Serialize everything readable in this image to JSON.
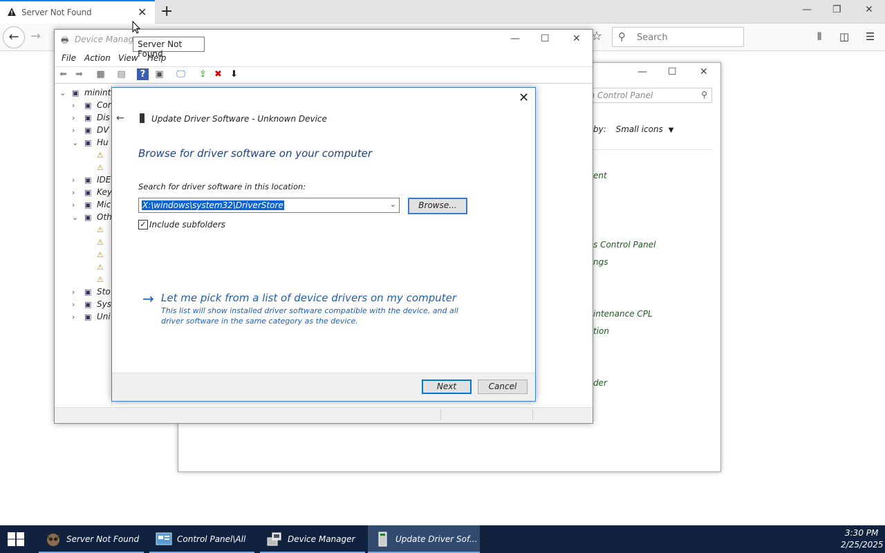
{
  "browser": {
    "tab_title": "Server Not Found",
    "tooltip": "Server Not Found",
    "search_placeholder": "Search"
  },
  "control_panel": {
    "search_placeholder": "rch Control Panel",
    "view_by_prefix": "by:",
    "view_by_value": "Small icons",
    "items": [
      "ent",
      "s Control Panel",
      "ngs",
      "intenance CPL",
      "tion",
      "der"
    ]
  },
  "device_manager": {
    "title": "Device Manage",
    "menu": [
      "File",
      "Action",
      "View",
      "Help"
    ],
    "tree": [
      {
        "label": "minint-",
        "chev": "⌄",
        "indent": 0
      },
      {
        "label": "Cor",
        "chev": "›",
        "indent": 1
      },
      {
        "label": "Dis",
        "chev": "›",
        "indent": 1
      },
      {
        "label": "DV",
        "chev": "›",
        "indent": 1
      },
      {
        "label": "Hu",
        "chev": "⌄",
        "indent": 1
      },
      {
        "label": "",
        "chev": "",
        "indent": 2
      },
      {
        "label": "",
        "chev": "",
        "indent": 2
      },
      {
        "label": "IDE",
        "chev": "›",
        "indent": 1
      },
      {
        "label": "Key",
        "chev": "›",
        "indent": 1
      },
      {
        "label": "Mic",
        "chev": "›",
        "indent": 1
      },
      {
        "label": "Oth",
        "chev": "⌄",
        "indent": 1
      },
      {
        "label": "",
        "chev": "",
        "indent": 2
      },
      {
        "label": "",
        "chev": "",
        "indent": 2
      },
      {
        "label": "",
        "chev": "",
        "indent": 2
      },
      {
        "label": "",
        "chev": "",
        "indent": 2
      },
      {
        "label": "",
        "chev": "",
        "indent": 2
      },
      {
        "label": "Sto",
        "chev": "›",
        "indent": 1
      },
      {
        "label": "Sys",
        "chev": "›",
        "indent": 1
      },
      {
        "label": "Uni",
        "chev": "›",
        "indent": 1
      }
    ]
  },
  "wizard": {
    "title": "Update Driver Software - Unknown Device",
    "heading": "Browse for driver software on your computer",
    "search_label": "Search for driver software in this location:",
    "path_value": "X:\\windows\\system32\\DriverStore",
    "browse_label": "Browse...",
    "include_subfolders_label": "Include subfolders",
    "include_subfolders_checked": true,
    "pick_link": "Let me pick from a list of device drivers on my computer",
    "pick_description": "This list will show installed driver software compatible with the device, and all driver software in the same category as the device.",
    "next_label": "Next",
    "cancel_label": "Cancel"
  },
  "taskbar": {
    "items": [
      {
        "label": "Server Not Found ...",
        "icon": "firefox-raccoon-icon"
      },
      {
        "label": "Control Panel\\All ...",
        "icon": "control-panel-icon"
      },
      {
        "label": "Device Manager",
        "icon": "device-manager-icon"
      },
      {
        "label": "Update Driver Sof...",
        "icon": "update-driver-icon"
      }
    ],
    "time": "3:30 PM",
    "date": "2/25/2025"
  },
  "colors": {
    "accent": "#0a84ff",
    "taskbar": "#10223d",
    "heading_blue": "#1e3f8a",
    "link_blue": "#1e5fb4",
    "selection": "#0a64d8"
  }
}
